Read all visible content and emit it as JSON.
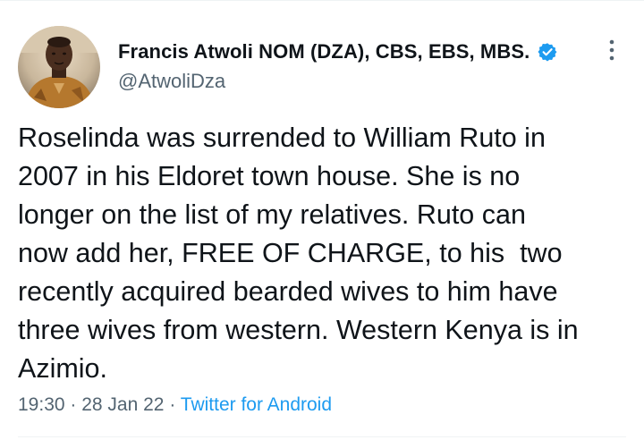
{
  "author": {
    "display_name": "Francis Atwoli NOM (DZA), CBS, EBS, MBS.",
    "handle": "@AtwoliDza",
    "verified": true,
    "avatar_icon": "profile-photo-icon"
  },
  "tweet": {
    "lines": [
      "Roselinda was surrended to William Ruto in",
      "2007 in his Eldoret town house. She is no",
      "longer on the list of my relatives. Ruto can",
      "now add her, FREE OF CHARGE, to his  two",
      "recently acquired bearded wives to him have",
      "three wives from western. Western Kenya is in",
      "Azimio."
    ]
  },
  "meta": {
    "time": "19:30",
    "separator": " · ",
    "date": "28 Jan 22",
    "source": "Twitter for Android"
  },
  "colors": {
    "text": "#0f1419",
    "secondary": "#536471",
    "accent": "#1d9bf0",
    "divider": "#eff3f4"
  }
}
